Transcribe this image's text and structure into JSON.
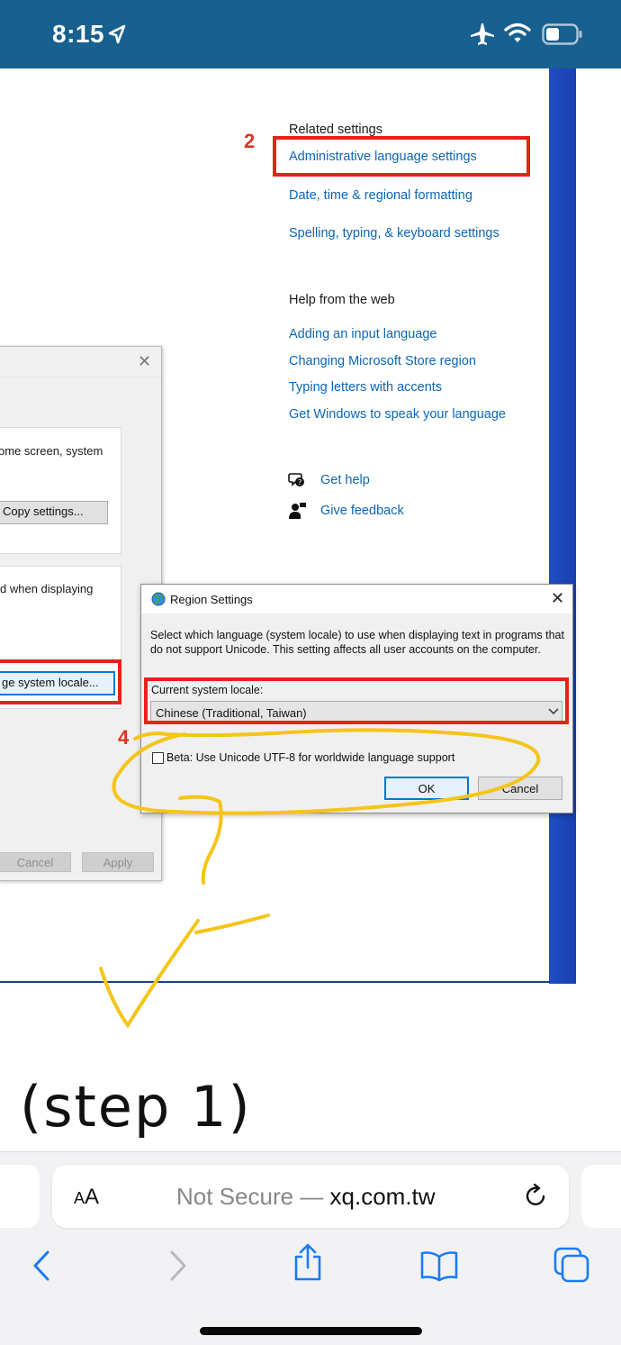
{
  "status_bar": {
    "time": "8:15",
    "icons": [
      "location-arrow-icon",
      "airplane-icon",
      "wifi-icon",
      "battery-icon"
    ]
  },
  "settings_panel": {
    "marker_2": "2",
    "related_heading": "Related settings",
    "related_links": [
      "Administrative language settings",
      "Date, time & regional formatting",
      "Spelling, typing, & keyboard settings"
    ],
    "help_heading": "Help from the web",
    "help_links": [
      "Adding an input language",
      "Changing Microsoft Store region",
      "Typing letters with accents",
      "Get Windows to speak your language"
    ],
    "get_help": "Get help",
    "give_feedback": "Give feedback"
  },
  "background_dialog": {
    "close_glyph": "✕",
    "panel1_text": "ome screen, system",
    "copy_settings_button": "Copy settings...",
    "panel2_text": "d when displaying",
    "change_locale_button": "ge system locale...",
    "cancel_button": "Cancel",
    "apply_button": "Apply"
  },
  "region_dialog": {
    "title": "Region Settings",
    "close_glyph": "✕",
    "description": "Select which language (system locale) to use when displaying text in programs that do not support Unicode. This setting affects all user accounts on the computer.",
    "current_locale_label": "Current system locale:",
    "current_locale_value": "Chinese (Traditional, Taiwan)",
    "marker_4": "4",
    "beta_checkbox_label": "Beta: Use Unicode UTF-8 for worldwide language support",
    "beta_checked": false,
    "ok_button": "OK",
    "cancel_button": "Cancel"
  },
  "caption": "(step 1)",
  "safari": {
    "text_size_button_small": "A",
    "text_size_button_large": "A",
    "url_prefix": "Not Secure — ",
    "url_host": "xq.com.tw",
    "toolbar_icons": [
      "back-icon",
      "forward-icon",
      "share-icon",
      "bookmarks-icon",
      "tabs-icon"
    ]
  },
  "colors": {
    "status_bar": "#17608f",
    "link": "#0a66b8",
    "annotation_red": "#e8221a",
    "highlighter_yellow": "#f5c518",
    "safari_blue": "#1a7cf5"
  }
}
